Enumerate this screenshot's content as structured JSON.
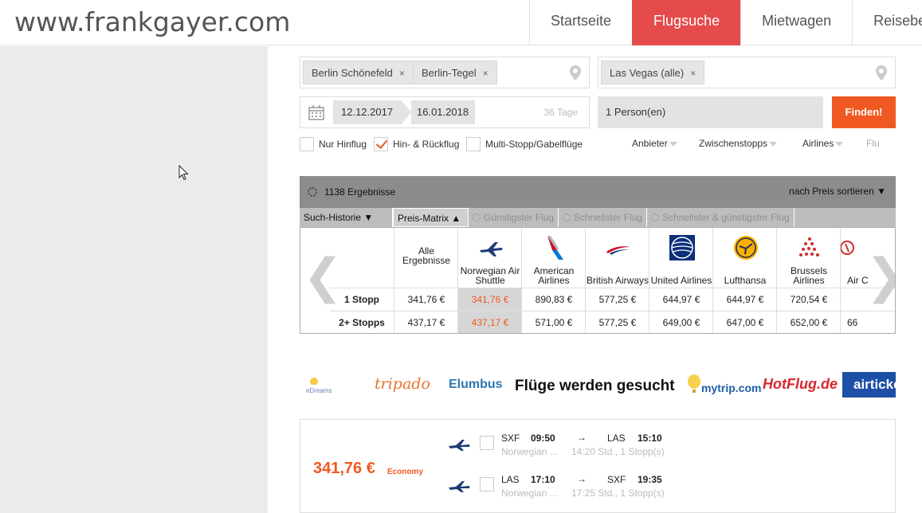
{
  "header": {
    "logo": "www.frankgayer.com",
    "nav": [
      "Startseite",
      "Flugsuche",
      "Mietwagen",
      "Reisebe"
    ]
  },
  "search": {
    "origins": [
      "Berlin Schönefeld",
      "Berlin-Tegel"
    ],
    "destinations": [
      "Las Vegas (alle)"
    ],
    "remove_glyph": "×",
    "depart_date": "12.12.2017",
    "return_date": "16.01.2018",
    "duration": "36 Tage",
    "persons": "1 Person(en)",
    "find_label": "Finden!"
  },
  "options": {
    "one_way": "Nur Hinflug",
    "round_trip": "Hin- & Rückflug",
    "multi_stop": "Multi-Stopp/Gabelflüge",
    "round_trip_checked": true
  },
  "filters": [
    "Anbieter",
    "Zwischenstopps",
    "Airlines",
    "Flu"
  ],
  "results": {
    "count_text": "1138 Ergebnisse",
    "sort_text": "nach Preis sortieren"
  },
  "tabs": [
    "Such-Historie ▼",
    "Preis-Matrix ▲",
    "Günstigster Flug",
    "Schnellster Flug",
    "Schnellster & günstigster Flug"
  ],
  "matrix": {
    "row_labels": [
      "1 Stopp",
      "2+ Stopps"
    ],
    "columns": [
      {
        "name": "Alle Ergebnisse",
        "prices": [
          "341,76 €",
          "437,17 €"
        ],
        "icon": "none"
      },
      {
        "name": "Norwegian Air Shuttle",
        "prices": [
          "341,76 €",
          "437,17 €"
        ],
        "icon": "plane-icon",
        "highlight": true
      },
      {
        "name": "American Airlines",
        "prices": [
          "890,83 €",
          "571,00 €"
        ],
        "icon": "american-airlines-logo"
      },
      {
        "name": "British Airways",
        "prices": [
          "577,25 €",
          "577,25 €"
        ],
        "icon": "british-airways-logo"
      },
      {
        "name": "United Airlines",
        "prices": [
          "644,97 €",
          "649,00 €"
        ],
        "icon": "united-globe-logo"
      },
      {
        "name": "Lufthansa",
        "prices": [
          "644,97 €",
          "647,00 €"
        ],
        "icon": "lufthansa-crane-logo"
      },
      {
        "name": "Brussels Airlines",
        "prices": [
          "720,54 €",
          "652,00 €"
        ],
        "icon": "brussels-airlines-logo"
      },
      {
        "name": "Air C",
        "prices": [
          "",
          "66"
        ],
        "icon": "air-china-logo"
      }
    ]
  },
  "partners": {
    "edreams": "eDreams",
    "tripado": "tripado",
    "elumbus": "Elumbus",
    "searching": "Flüge werden gesucht",
    "mytrip": "mytrip.com",
    "hotflug": "HotFlug.de",
    "airtickets": "airticke"
  },
  "result_card": {
    "price": "341,76 €",
    "cabin": "Economy",
    "legs": [
      {
        "from": "SXF",
        "dep": "09:50",
        "arrow": "→",
        "to": "LAS",
        "arr": "15:10",
        "carrier": "Norwegian ...",
        "duration": "14:20 Std., 1 Stopp(s)"
      },
      {
        "from": "LAS",
        "dep": "17:10",
        "arrow": "→",
        "to": "SXF",
        "arr": "19:35",
        "carrier": "Norwegian ...",
        "duration": "17:25 Std., 1 Stopp(s)"
      }
    ]
  },
  "colors": {
    "accent": "#e54b4b",
    "orange": "#f05a22"
  }
}
